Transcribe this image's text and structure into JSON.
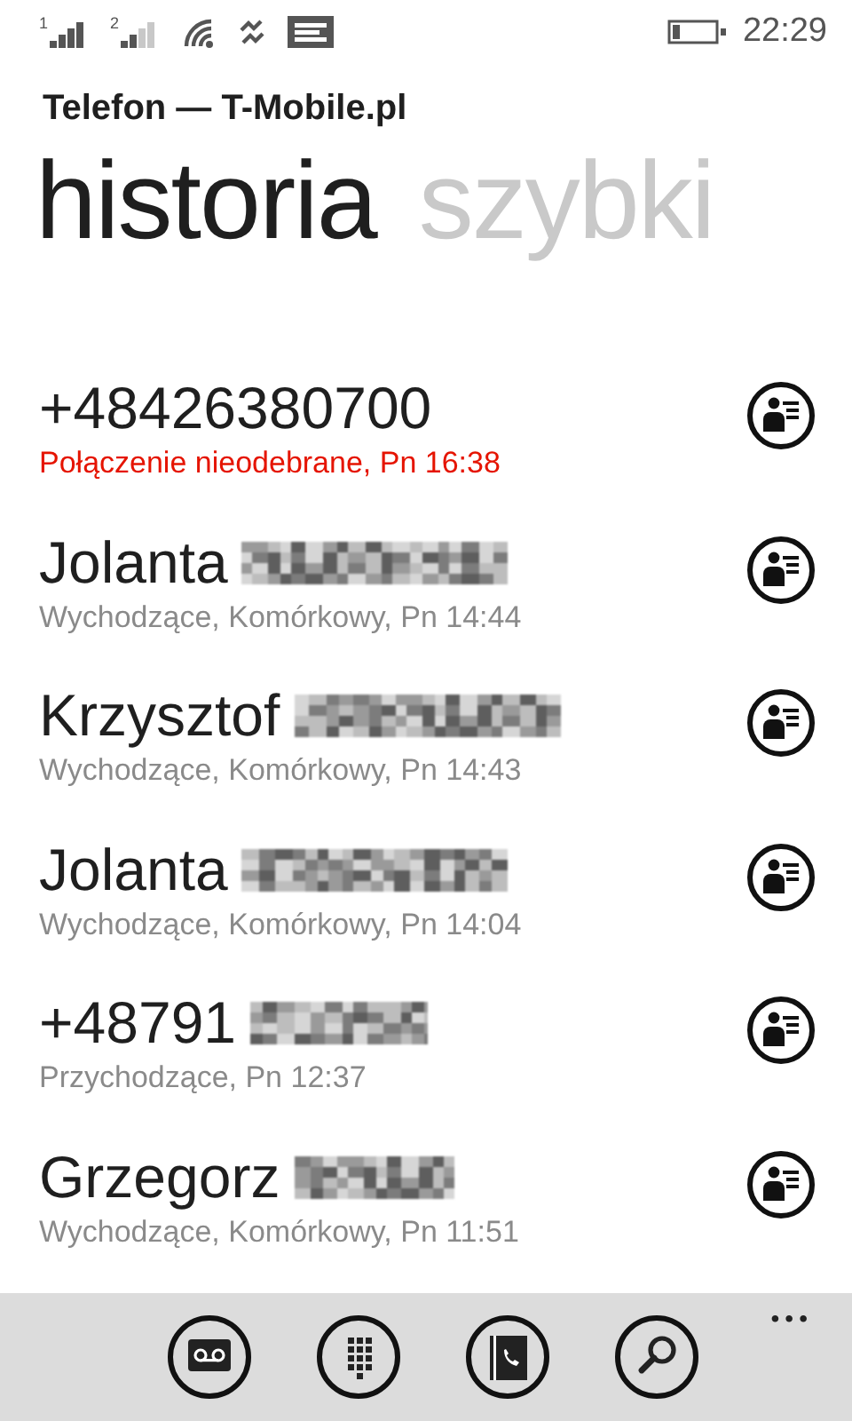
{
  "status_bar": {
    "sim_1": "1",
    "sim_2": "2",
    "time": "22:29"
  },
  "app_title": "Telefon — T-Mobile.pl",
  "pivots": [
    {
      "label": "historia",
      "selected": true
    },
    {
      "label": "szybki",
      "selected": false
    }
  ],
  "calls": [
    {
      "name": "+48426380700",
      "detail": "Połączenie nieodebrane, Pn 16:38",
      "missed": true,
      "redacted": false
    },
    {
      "name": "Jolanta",
      "detail": "Wychodzące, Komórkowy, Pn 14:44",
      "missed": false,
      "redacted": true
    },
    {
      "name": "Krzysztof",
      "detail": "Wychodzące, Komórkowy, Pn 14:43",
      "missed": false,
      "redacted": true
    },
    {
      "name": "Jolanta",
      "detail": "Wychodzące, Komórkowy, Pn 14:04",
      "missed": false,
      "redacted": true
    },
    {
      "name": "+48791",
      "detail": "Przychodzące, Pn 12:37",
      "missed": false,
      "redacted": true
    },
    {
      "name": "Grzegorz",
      "detail": "Wychodzące, Komórkowy, Pn 11:51",
      "missed": false,
      "redacted": true
    }
  ],
  "app_bar": {
    "buttons": [
      {
        "kind": "voicemail"
      },
      {
        "kind": "keypad"
      },
      {
        "kind": "contacts"
      },
      {
        "kind": "search"
      }
    ],
    "more": "•••"
  }
}
